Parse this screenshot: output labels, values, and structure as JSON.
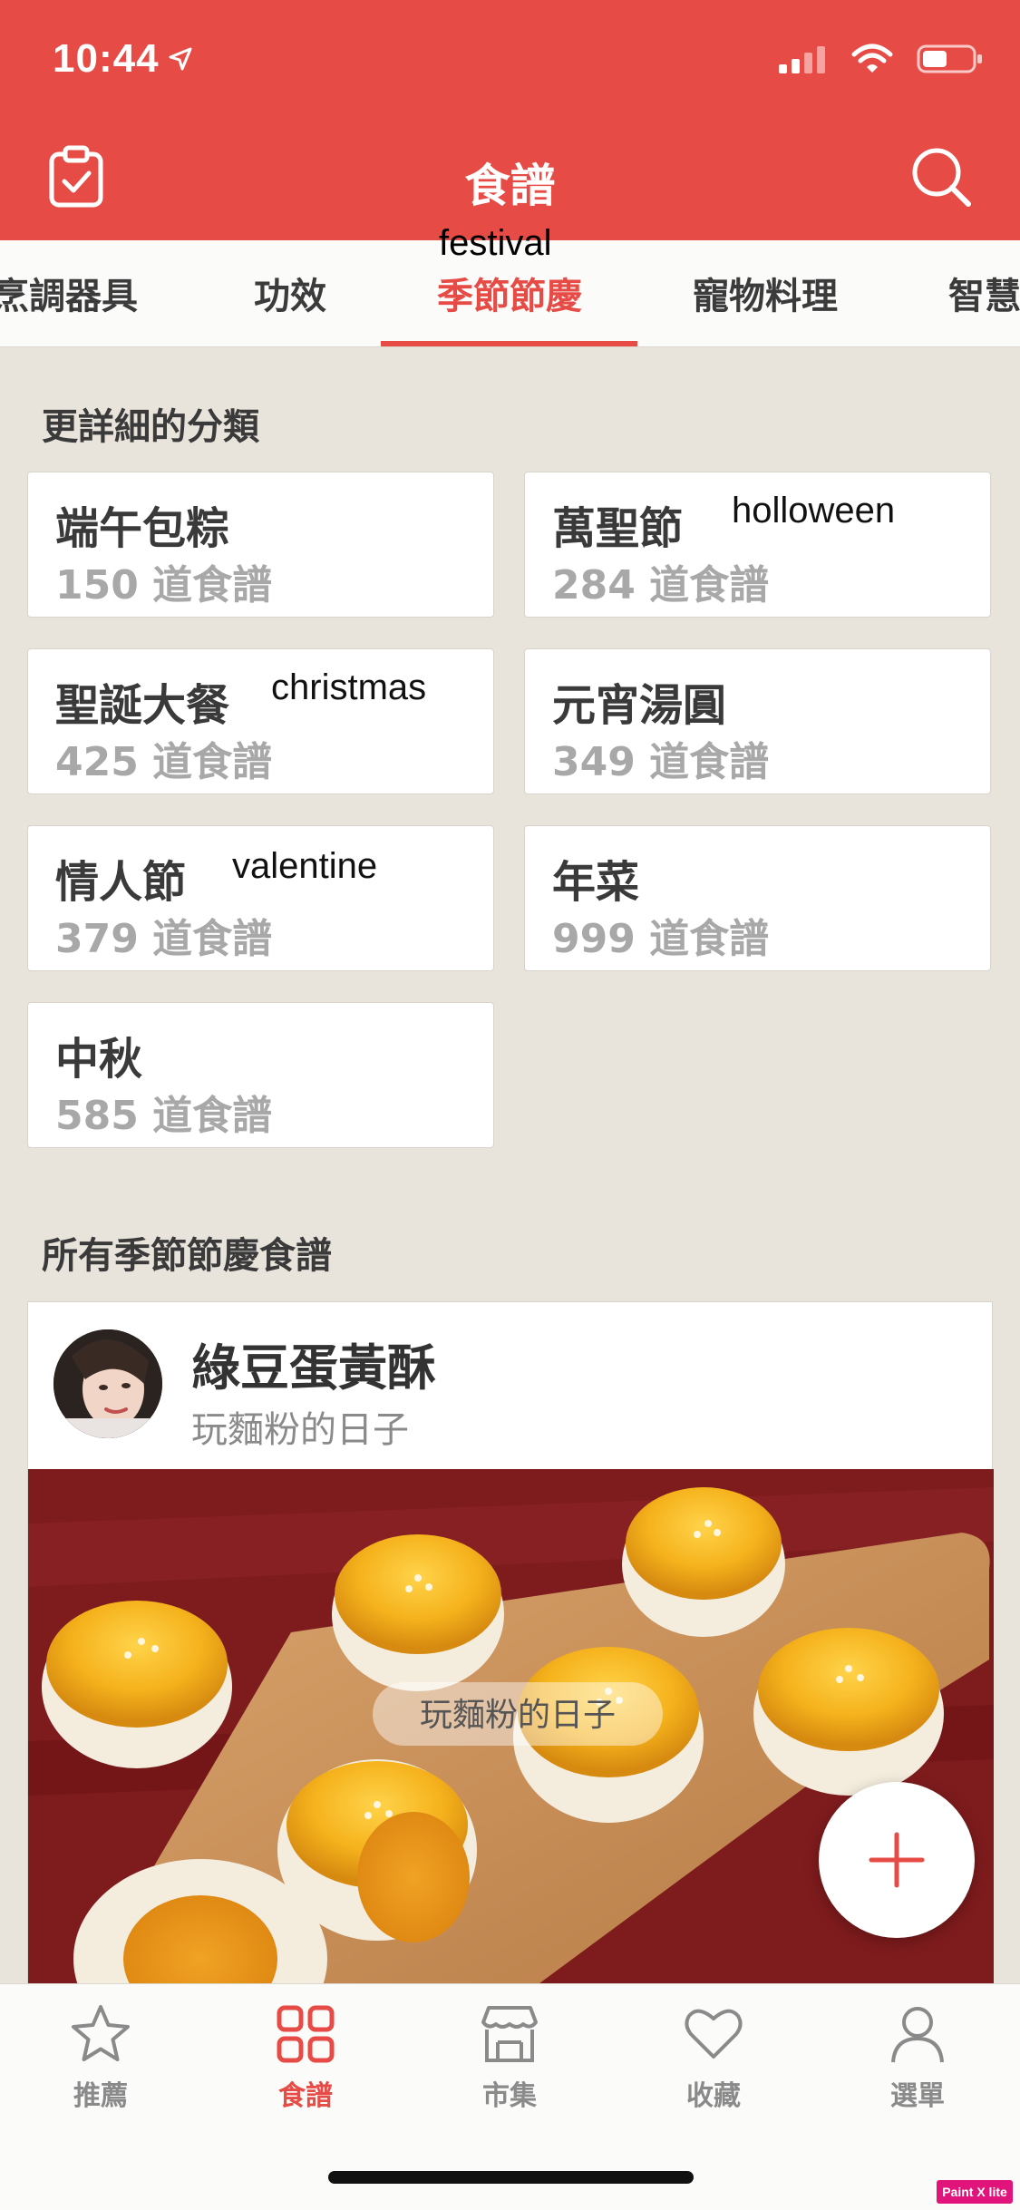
{
  "status_bar": {
    "time": "10:44"
  },
  "header": {
    "title": "食譜"
  },
  "tabs": [
    {
      "label": "烹調器具"
    },
    {
      "label": "功效"
    },
    {
      "label": "季節節慶",
      "active": true
    },
    {
      "label": "寵物料理"
    },
    {
      "label": "智慧"
    }
  ],
  "annotations": {
    "festival": "festival",
    "holloween": "holloween",
    "christmas": "christmas",
    "valentine": "valentine"
  },
  "subcategories": {
    "heading": "更詳細的分類",
    "items": [
      {
        "name": "端午包粽",
        "count": "150 道食譜"
      },
      {
        "name": "萬聖節",
        "count": "284 道食譜"
      },
      {
        "name": "聖誕大餐",
        "count": "425 道食譜"
      },
      {
        "name": "元宵湯圓",
        "count": "349 道食譜"
      },
      {
        "name": "情人節",
        "count": "379 道食譜"
      },
      {
        "name": "年菜",
        "count": "999 道食譜"
      },
      {
        "name": "中秋",
        "count": "585 道食譜"
      }
    ]
  },
  "all_recipes": {
    "heading": "所有季節節慶食譜",
    "recipe": {
      "title": "綠豆蛋黃酥",
      "author": "玩麵粉的日子",
      "watermark": "玩麵粉的日子"
    }
  },
  "bottom_nav": [
    {
      "label": "推薦"
    },
    {
      "label": "食譜",
      "active": true
    },
    {
      "label": "市集"
    },
    {
      "label": "收藏"
    },
    {
      "label": "選單"
    }
  ],
  "badge": "Paint X lite",
  "colors": {
    "accent": "#e64b45",
    "background": "#e8e4dc"
  }
}
